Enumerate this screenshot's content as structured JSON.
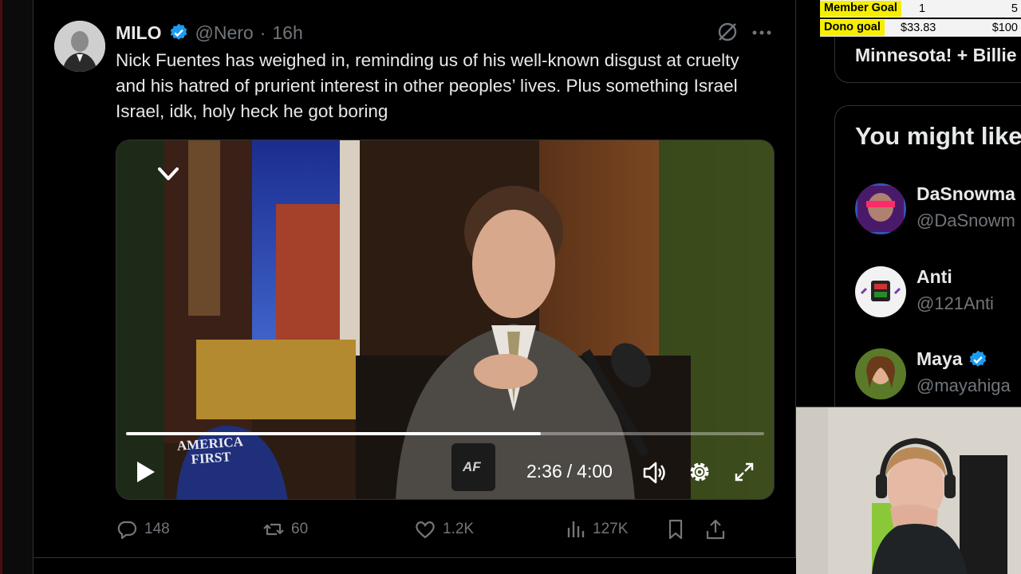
{
  "tweet": {
    "author_name": "MILO",
    "handle": "@Nero",
    "separator": "·",
    "time": "16h",
    "text": "Nick Fuentes has weighed in, reminding us of his well-known disgust at cruelty and his hatred of prurient interest in other peoples’ lives. Plus something Israel Israel, idk, holy heck he got boring"
  },
  "video": {
    "current_time": "2:36",
    "separator": "/",
    "duration": "4:00",
    "progress": 0.65,
    "hat_text_line1": "AMERICA",
    "hat_text_line2": "FIRST",
    "mug_text": "AF"
  },
  "actions": {
    "replies": "148",
    "reposts": "60",
    "likes": "1.2K",
    "views": "127K"
  },
  "sidebar": {
    "trend_text": "Minnesota! + Billie",
    "who_to_follow_title": "You might like",
    "suggestions": [
      {
        "name": "DaSnowma",
        "handle": "@DaSnowm",
        "verified": false
      },
      {
        "name": "Anti",
        "handle": "@121Anti",
        "verified": false
      },
      {
        "name": "Maya",
        "handle": "@mayahiga",
        "verified": true
      }
    ]
  },
  "overlay": {
    "member_goal_label": "Member Goal",
    "member_goal_current": "1",
    "member_goal_target": "5",
    "dono_goal_label": "Dono goal",
    "dono_goal_current": "$33.83",
    "dono_goal_target": "$100"
  },
  "colors": {
    "background": "#000000",
    "text_primary": "#e7e9ea",
    "text_secondary": "#71767b",
    "verified_blue": "#1d9bf0",
    "border": "#2f3336",
    "goal_highlight": "#f5ee00"
  }
}
